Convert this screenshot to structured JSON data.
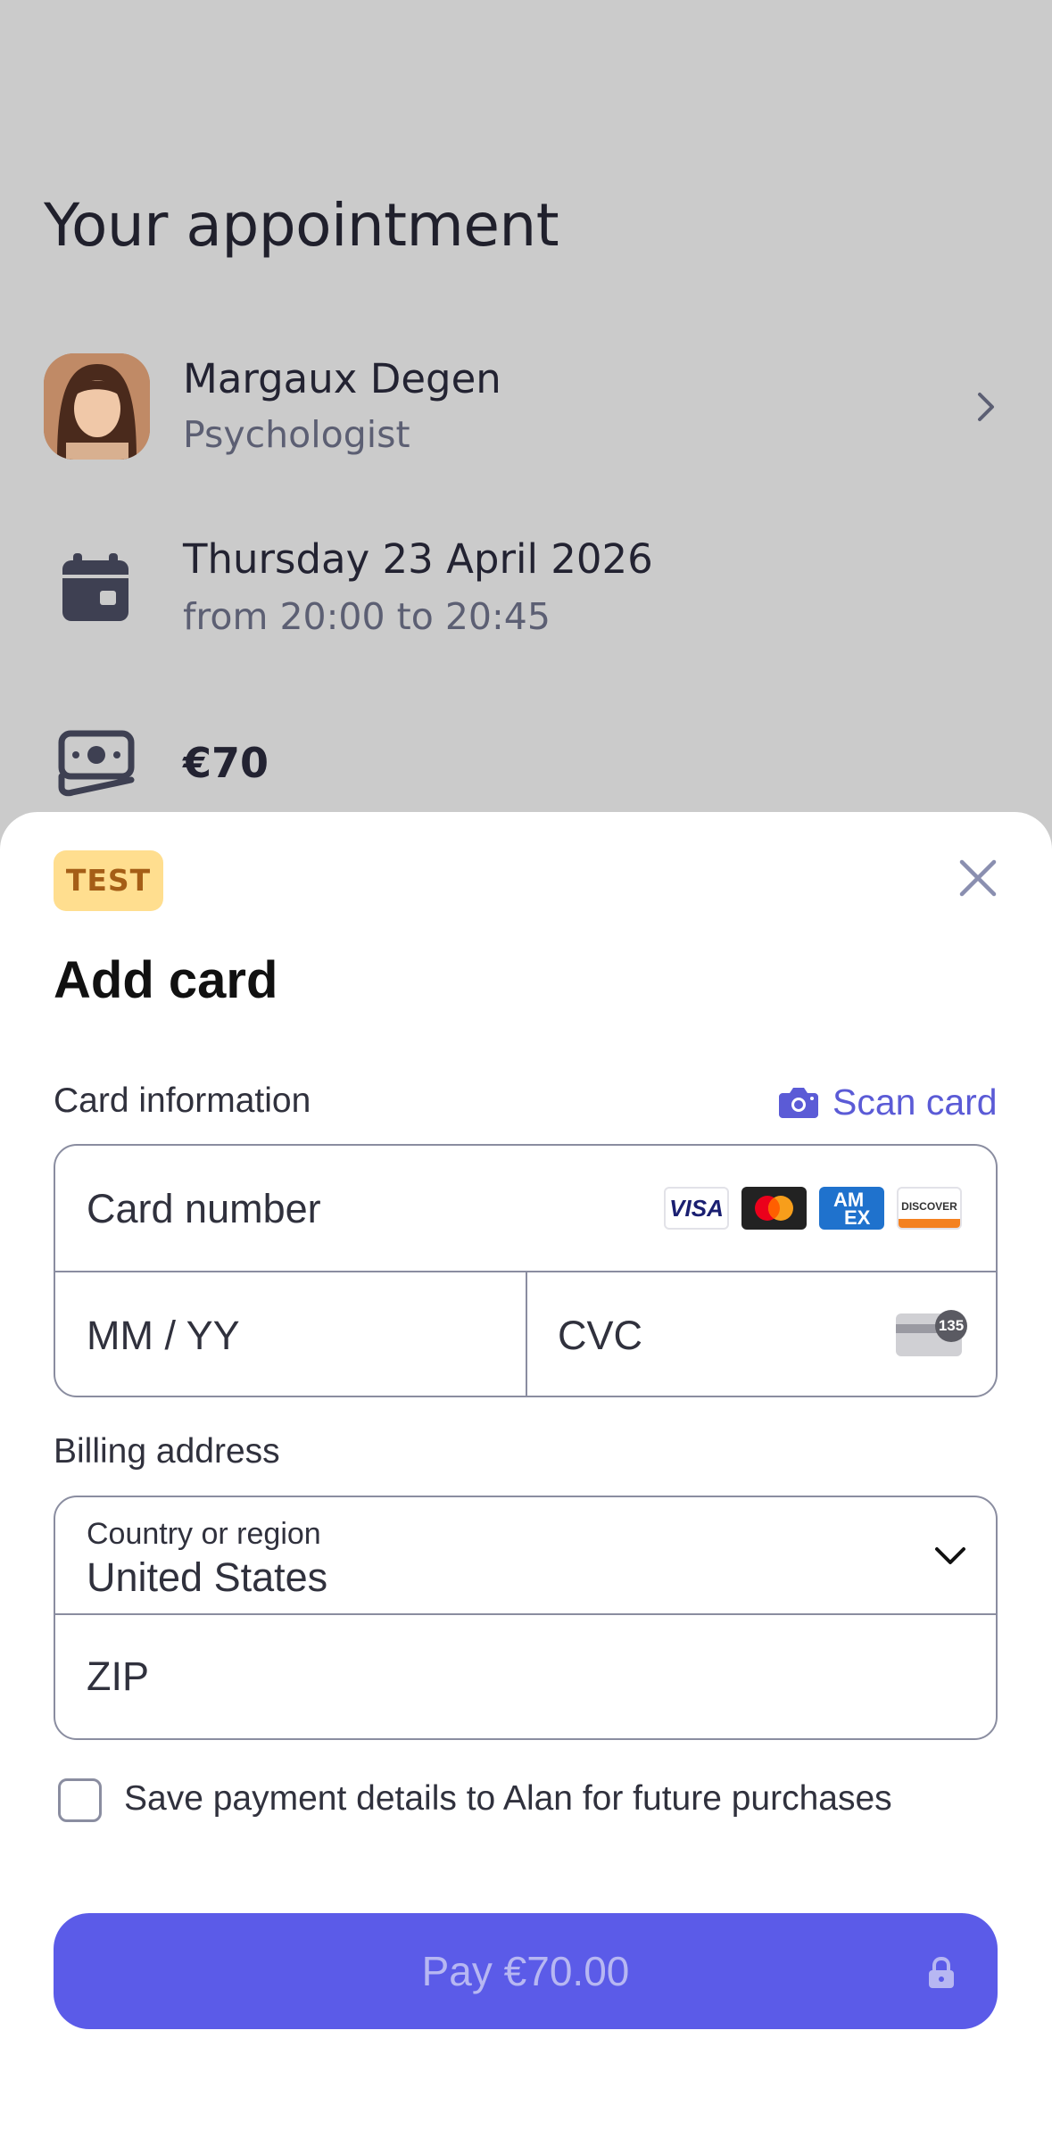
{
  "appointment": {
    "title": "Your appointment",
    "practitioner_name": "Margaux Degen",
    "practitioner_role": "Psychologist",
    "date": "Thursday 23 April 2026",
    "time": "from 20:00 to 20:45",
    "price": "€70"
  },
  "sheet": {
    "badge": "TEST",
    "title": "Add card",
    "card_info_label": "Card information",
    "scan_card_label": "Scan card",
    "card_number_placeholder": "Card number",
    "expiry_placeholder": "MM / YY",
    "cvc_placeholder": "CVC",
    "cvc_icon_number": "135",
    "brands": [
      "visa-icon",
      "mastercard-icon",
      "amex-icon",
      "discover-icon"
    ],
    "brand_texts": {
      "visa": "VISA",
      "amex_1": "AM",
      "amex_2": "EX",
      "discover": "DISCOVER"
    },
    "billing_label": "Billing address",
    "country_label": "Country or region",
    "country_value": "United States",
    "zip_placeholder": "ZIP",
    "save_checkbox_label": "Save payment details to Alan for future purchases",
    "pay_button_label": "Pay €70.00"
  },
  "colors": {
    "accent": "#5b5be8",
    "link": "#5b5bd6",
    "badge_bg": "#ffde8f",
    "badge_text": "#a55e17",
    "overlay_bg": "#cbcbcb"
  }
}
